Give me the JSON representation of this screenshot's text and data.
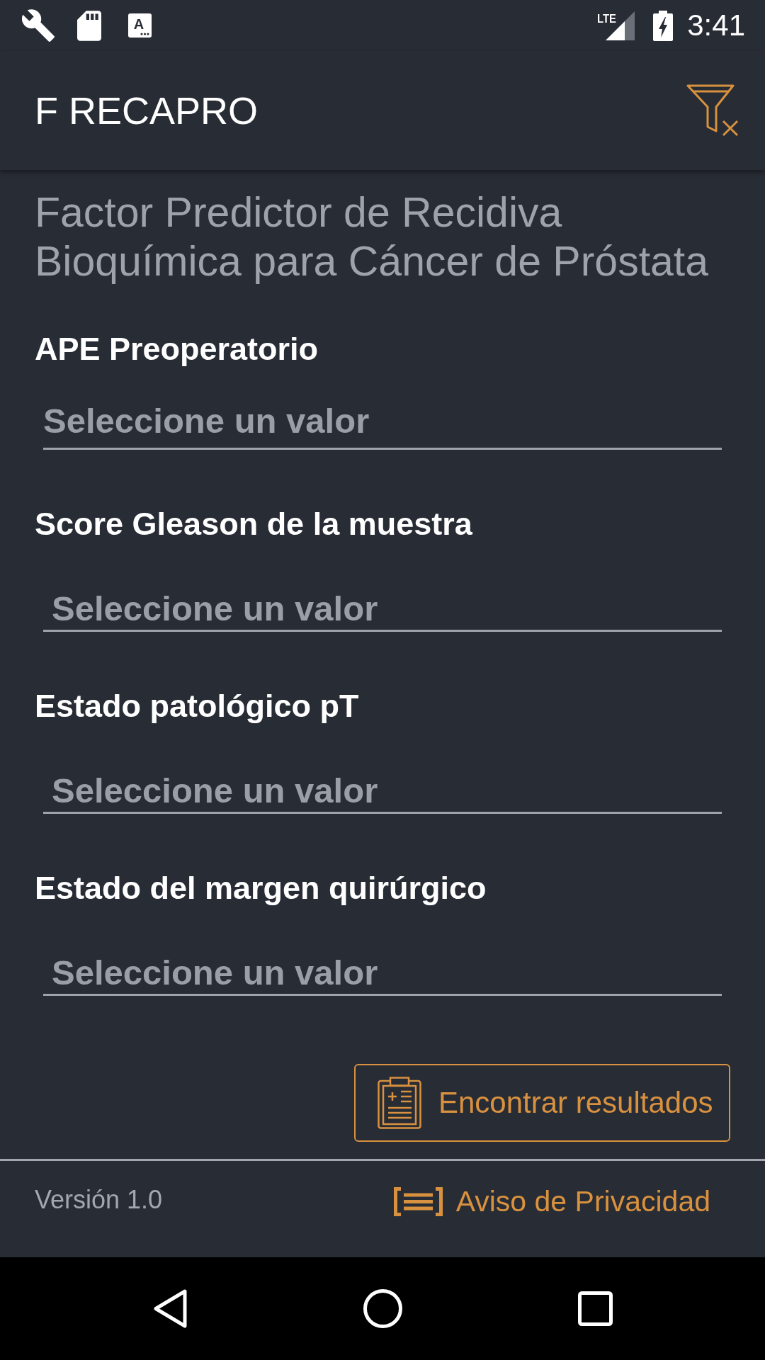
{
  "status_bar": {
    "notification_letter": "A",
    "network_label": "LTE",
    "time": "3:41"
  },
  "app_bar": {
    "title": "F RECAPRO"
  },
  "form": {
    "heading": "Factor Predictor de Recidiva Bioquímica para Cáncer de Próstata",
    "fields": [
      {
        "label": "APE Preoperatorio",
        "kind": "input",
        "placeholder": "Seleccione un valor"
      },
      {
        "label": "Score Gleason de la muestra",
        "kind": "select",
        "placeholder": "Seleccione un valor"
      },
      {
        "label": "Estado patológico pT",
        "kind": "select",
        "placeholder": "Seleccione un valor"
      },
      {
        "label": "Estado del margen quirúrgico",
        "kind": "select",
        "placeholder": "Seleccione un valor"
      }
    ],
    "submit_button": "Encontrar resultados"
  },
  "footer": {
    "version": "Versión 1.0",
    "privacy_link": "Aviso de Privacidad"
  }
}
